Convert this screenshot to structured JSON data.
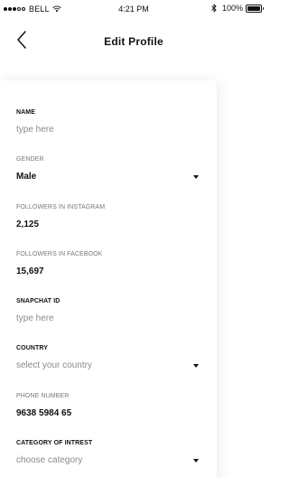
{
  "status_bar": {
    "carrier": "BELL",
    "time": "4:21 PM",
    "battery": "100%",
    "signal": {
      "filled": 3,
      "total": 5
    }
  },
  "header": {
    "title": "Edit Profile",
    "back_icon": "chevron-left-icon"
  },
  "form": {
    "name": {
      "label": "NAME",
      "placeholder": "type here"
    },
    "gender": {
      "label": "GENDER",
      "value": "Male"
    },
    "followers_instagram": {
      "label": "FOLLOWERS IN INSTAGRAM",
      "value": "2,125"
    },
    "followers_facebook": {
      "label": "FOLLOWERS IN FACEBOOK",
      "value": "15,697"
    },
    "snapchat_id": {
      "label": "SNAPCHAT ID",
      "placeholder": "type here"
    },
    "country": {
      "label": "COUNTRY",
      "placeholder": "select your country"
    },
    "phone_number": {
      "label": "PHONE NUMBER",
      "value": "9638 5984 65"
    },
    "category": {
      "label": "CATEGORY OF INTREST",
      "placeholder": "choose category"
    }
  },
  "colors": {
    "text": "#111111",
    "placeholder": "#8a8a8a",
    "light_label": "#777777",
    "background": "#ffffff"
  }
}
